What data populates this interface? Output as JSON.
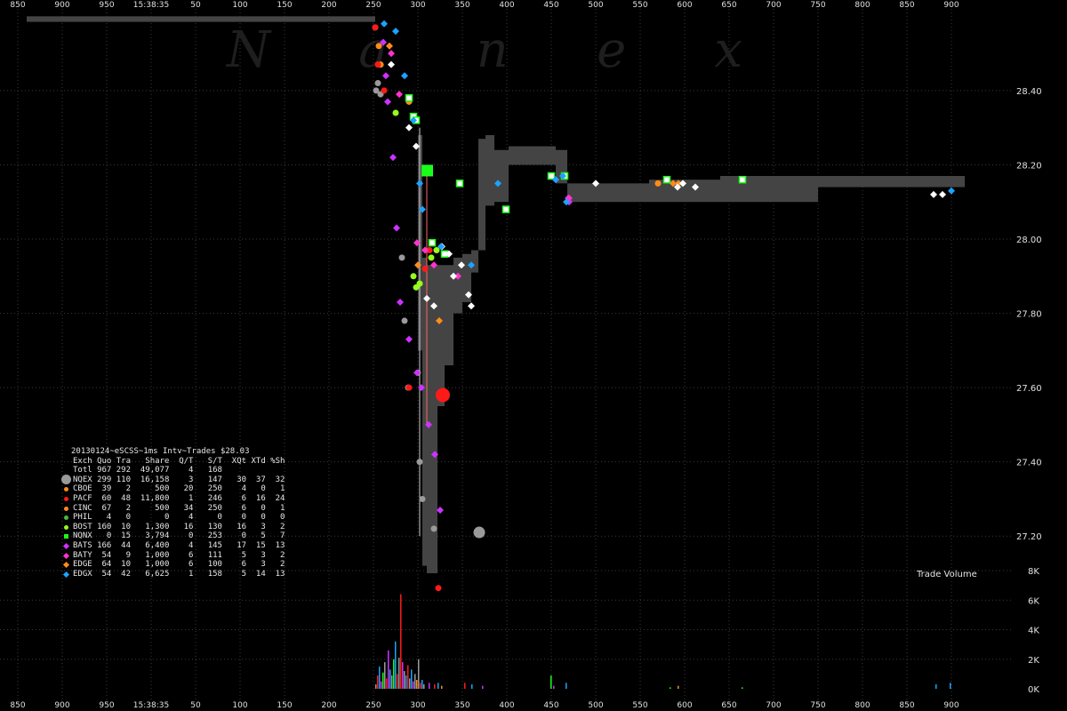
{
  "watermark": "Nanex",
  "chart_data": {
    "type": "scatter",
    "x_axis_labels": [
      "850",
      "900",
      "950",
      "15:38:35",
      "50",
      "100",
      "150",
      "200",
      "250",
      "300",
      "350",
      "400",
      "450",
      "500",
      "550",
      "600",
      "650",
      "700",
      "750",
      "800",
      "850",
      "900"
    ],
    "y_axis_labels": [
      "28.40",
      "28.20",
      "28.00",
      "27.80",
      "27.60",
      "27.40",
      "27.20"
    ],
    "volume_axis_labels": [
      "8K",
      "6K",
      "4K",
      "2K",
      "0K"
    ],
    "volume_label": "Trade Volume",
    "ylim": [
      27.1,
      28.62
    ],
    "nbbo_band": [
      {
        "x0": -140,
        "x1": 252,
        "lo": 28.585,
        "hi": 28.6
      },
      {
        "x0": 300,
        "x1": 305,
        "lo": 27.7,
        "hi": 28.28
      },
      {
        "x0": 305,
        "x1": 310,
        "lo": 27.12,
        "hi": 27.95
      },
      {
        "x0": 310,
        "x1": 322,
        "lo": 27.1,
        "hi": 27.93
      },
      {
        "x0": 322,
        "x1": 330,
        "lo": 27.55,
        "hi": 27.93
      },
      {
        "x0": 330,
        "x1": 340,
        "lo": 27.66,
        "hi": 27.93
      },
      {
        "x0": 340,
        "x1": 350,
        "lo": 27.8,
        "hi": 27.95
      },
      {
        "x0": 350,
        "x1": 360,
        "lo": 27.83,
        "hi": 27.96
      },
      {
        "x0": 360,
        "x1": 368,
        "lo": 27.91,
        "hi": 27.97
      },
      {
        "x0": 368,
        "x1": 376,
        "lo": 27.97,
        "hi": 28.27
      },
      {
        "x0": 376,
        "x1": 386,
        "lo": 28.09,
        "hi": 28.28
      },
      {
        "x0": 386,
        "x1": 402,
        "lo": 28.1,
        "hi": 28.24
      },
      {
        "x0": 402,
        "x1": 455,
        "lo": 28.2,
        "hi": 28.25
      },
      {
        "x0": 455,
        "x1": 468,
        "lo": 28.15,
        "hi": 28.24
      },
      {
        "x0": 468,
        "x1": 560,
        "lo": 28.1,
        "hi": 28.15
      },
      {
        "x0": 560,
        "x1": 640,
        "lo": 28.1,
        "hi": 28.16
      },
      {
        "x0": 640,
        "x1": 750,
        "lo": 28.1,
        "hi": 28.17
      },
      {
        "x0": 750,
        "x1": 820,
        "lo": 28.14,
        "hi": 28.17
      },
      {
        "x0": 820,
        "x1": 915,
        "lo": 28.14,
        "hi": 28.17
      }
    ],
    "series": [
      {
        "name": "NQEX",
        "color": "#9a9a9a",
        "shape": "circle",
        "x": [
          252,
          253,
          255,
          258,
          282,
          285,
          289,
          300,
          302,
          305,
          318
        ],
        "y": [
          28.57,
          28.4,
          28.42,
          28.39,
          27.95,
          27.78,
          27.6,
          27.64,
          27.4,
          27.3,
          27.22
        ]
      },
      {
        "name": "CBOE",
        "color": "#ff8c1a",
        "shape": "circle",
        "x": [
          256,
          258,
          290,
          347,
          570
        ],
        "y": [
          28.52,
          28.47,
          28.37,
          28.15,
          28.15
        ]
      },
      {
        "name": "PACF",
        "color": "#ff1a1a",
        "shape": "circle",
        "x": [
          252,
          255,
          262,
          290,
          308,
          313,
          323
        ],
        "y": [
          28.57,
          28.47,
          28.4,
          27.6,
          27.92,
          27.97,
          27.06
        ]
      },
      {
        "name": "CINC",
        "color": "#ff8c1a",
        "shape": "diamond",
        "x": [
          268,
          300,
          324,
          587,
          593
        ],
        "y": [
          28.52,
          27.93,
          27.78,
          28.15,
          28.15
        ]
      },
      {
        "name": "BOST",
        "color": "#96ff1a",
        "shape": "circle",
        "x": [
          275,
          295,
          298,
          302,
          315,
          321
        ],
        "y": [
          28.34,
          27.9,
          27.87,
          27.88,
          27.95,
          27.97
        ]
      },
      {
        "name": "NQNX",
        "color": "#1aff1a",
        "shape": "square",
        "x": [
          290,
          295,
          298,
          316,
          330,
          347,
          399,
          450,
          465,
          580,
          665
        ],
        "y": [
          28.38,
          28.33,
          28.32,
          27.99,
          27.96,
          28.15,
          28.08,
          28.17,
          28.17,
          28.16,
          28.16
        ]
      },
      {
        "name": "BATS",
        "color": "#cc33ff",
        "shape": "diamond",
        "x": [
          261,
          264,
          266,
          272,
          276,
          280,
          290,
          299,
          304,
          312,
          319,
          325,
          455,
          469,
          470
        ],
        "y": [
          28.53,
          28.44,
          28.37,
          28.22,
          28.03,
          27.83,
          27.73,
          27.64,
          27.6,
          27.5,
          27.42,
          27.27,
          28.16,
          28.11,
          28.1
        ]
      },
      {
        "name": "BATY",
        "color": "#ff33cc",
        "shape": "diamond",
        "x": [
          270,
          279,
          299,
          308,
          318,
          345,
          470
        ],
        "y": [
          28.5,
          28.39,
          27.99,
          27.97,
          27.93,
          27.9,
          28.11
        ]
      },
      {
        "name": "EDGE",
        "color": "#ffffff",
        "shape": "diamond",
        "x": [
          270,
          290,
          298,
          310,
          318,
          327,
          335,
          340,
          349,
          357,
          360,
          500,
          592,
          598,
          612,
          880,
          890
        ],
        "y": [
          28.47,
          28.3,
          28.25,
          27.84,
          27.82,
          27.98,
          27.96,
          27.9,
          27.93,
          27.85,
          27.82,
          28.15,
          28.14,
          28.15,
          28.14,
          28.12,
          28.12
        ]
      },
      {
        "name": "EDGX",
        "color": "#1aa3ff",
        "shape": "diamond",
        "x": [
          262,
          275,
          285,
          295,
          302,
          305,
          326,
          360,
          390,
          455,
          463,
          467,
          900
        ],
        "y": [
          28.58,
          28.56,
          28.44,
          28.32,
          28.15,
          28.08,
          27.98,
          27.93,
          28.15,
          28.16,
          28.17,
          28.1,
          28.13
        ]
      }
    ],
    "legend_title": "20130124~eSCSS~1ms Intv~Trades $28.03",
    "legend_columns": [
      "Exch",
      "Quo",
      "Tra",
      "Share",
      "Q/T",
      "S/T",
      "XQt",
      "XTd",
      "%Sh"
    ],
    "legend_rows": [
      {
        "exch": "Totl",
        "quo": "967",
        "tra": "292",
        "share": "49,077",
        "qt": "4",
        "st": "168",
        "xqt": "",
        "xtd": "",
        "sh": ""
      },
      {
        "exch": "NQEX",
        "quo": "299",
        "tra": "110",
        "share": "16,158",
        "qt": "3",
        "st": "147",
        "xqt": "30",
        "xtd": "37",
        "sh": "32"
      },
      {
        "exch": "CBOE",
        "quo": "39",
        "tra": "2",
        "share": "500",
        "qt": "20",
        "st": "250",
        "xqt": "4",
        "xtd": "0",
        "sh": "1"
      },
      {
        "exch": "PACF",
        "quo": "60",
        "tra": "48",
        "share": "11,800",
        "qt": "1",
        "st": "246",
        "xqt": "6",
        "xtd": "16",
        "sh": "24"
      },
      {
        "exch": "CINC",
        "quo": "67",
        "tra": "2",
        "share": "500",
        "qt": "34",
        "st": "250",
        "xqt": "6",
        "xtd": "0",
        "sh": "1"
      },
      {
        "exch": "PHIL",
        "quo": "4",
        "tra": "0",
        "share": "0",
        "qt": "4",
        "st": "0",
        "xqt": "0",
        "xtd": "0",
        "sh": "0"
      },
      {
        "exch": "BOST",
        "quo": "160",
        "tra": "10",
        "share": "1,300",
        "qt": "16",
        "st": "130",
        "xqt": "16",
        "xtd": "3",
        "sh": "2"
      },
      {
        "exch": "NQNX",
        "quo": "0",
        "tra": "15",
        "share": "3,794",
        "qt": "0",
        "st": "253",
        "xqt": "0",
        "xtd": "5",
        "sh": "7"
      },
      {
        "exch": "BATS",
        "quo": "166",
        "tra": "44",
        "share": "6,400",
        "qt": "4",
        "st": "145",
        "xqt": "17",
        "xtd": "15",
        "sh": "13"
      },
      {
        "exch": "BATY",
        "quo": "54",
        "tra": "9",
        "share": "1,000",
        "qt": "6",
        "st": "111",
        "xqt": "5",
        "xtd": "3",
        "sh": "2"
      },
      {
        "exch": "EDGE",
        "quo": "64",
        "tra": "10",
        "share": "1,000",
        "qt": "6",
        "st": "100",
        "xqt": "6",
        "xtd": "3",
        "sh": "2"
      },
      {
        "exch": "EDGX",
        "quo": "54",
        "tra": "42",
        "share": "6,625",
        "qt": "1",
        "st": "158",
        "xqt": "5",
        "xtd": "14",
        "sh": "13"
      }
    ],
    "legend_markers": {
      "NQEX": {
        "color": "#9a9a9a",
        "shape": "big"
      },
      "CBOE": {
        "color": "#ff8c1a",
        "shape": "dot"
      },
      "PACF": {
        "color": "#ff1a1a",
        "shape": "dot"
      },
      "CINC": {
        "color": "#ff8c1a",
        "shape": "dot"
      },
      "PHIL": {
        "color": "#40c040",
        "shape": "dot"
      },
      "BOST": {
        "color": "#96ff1a",
        "shape": "dot"
      },
      "NQNX": {
        "color": "#1aff1a",
        "shape": "sq"
      },
      "BATS": {
        "color": "#cc33ff",
        "shape": "dia"
      },
      "BATY": {
        "color": "#ff33cc",
        "shape": "dia"
      },
      "EDGE": {
        "color": "#ff8c1a",
        "shape": "dia"
      },
      "EDGX": {
        "color": "#1aa3ff",
        "shape": "dia"
      }
    },
    "volume_bars": [
      {
        "x": 252,
        "v": 300,
        "c": "#9a9a9a"
      },
      {
        "x": 254,
        "v": 900,
        "c": "#ff1a1a"
      },
      {
        "x": 256,
        "v": 1500,
        "c": "#1aa3ff"
      },
      {
        "x": 258,
        "v": 500,
        "c": "#cc33ff"
      },
      {
        "x": 260,
        "v": 1100,
        "c": "#1aff1a"
      },
      {
        "x": 262,
        "v": 1800,
        "c": "#9a9a9a"
      },
      {
        "x": 264,
        "v": 700,
        "c": "#ff1a1a"
      },
      {
        "x": 266,
        "v": 2600,
        "c": "#cc33ff"
      },
      {
        "x": 268,
        "v": 1300,
        "c": "#1aa3ff"
      },
      {
        "x": 270,
        "v": 900,
        "c": "#9a9a9a"
      },
      {
        "x": 272,
        "v": 2000,
        "c": "#1aff1a"
      },
      {
        "x": 274,
        "v": 3200,
        "c": "#1aa3ff"
      },
      {
        "x": 276,
        "v": 1000,
        "c": "#ff1a1a"
      },
      {
        "x": 278,
        "v": 2100,
        "c": "#9a9a9a"
      },
      {
        "x": 280,
        "v": 6400,
        "c": "#ff1a1a"
      },
      {
        "x": 282,
        "v": 1800,
        "c": "#cc33ff"
      },
      {
        "x": 284,
        "v": 1200,
        "c": "#9a9a9a"
      },
      {
        "x": 286,
        "v": 900,
        "c": "#1aa3ff"
      },
      {
        "x": 288,
        "v": 1600,
        "c": "#ff1a1a"
      },
      {
        "x": 290,
        "v": 700,
        "c": "#9a9a9a"
      },
      {
        "x": 292,
        "v": 1300,
        "c": "#1aa3ff"
      },
      {
        "x": 294,
        "v": 500,
        "c": "#cc33ff"
      },
      {
        "x": 296,
        "v": 1000,
        "c": "#9a9a9a"
      },
      {
        "x": 298,
        "v": 600,
        "c": "#ff8c1a"
      },
      {
        "x": 300,
        "v": 2000,
        "c": "#9a9a9a"
      },
      {
        "x": 302,
        "v": 400,
        "c": "#ff1a1a"
      },
      {
        "x": 304,
        "v": 600,
        "c": "#1aa3ff"
      },
      {
        "x": 306,
        "v": 300,
        "c": "#9a9a9a"
      },
      {
        "x": 312,
        "v": 400,
        "c": "#cc33ff"
      },
      {
        "x": 318,
        "v": 300,
        "c": "#ff1a1a"
      },
      {
        "x": 322,
        "v": 400,
        "c": "#1aa3ff"
      },
      {
        "x": 326,
        "v": 200,
        "c": "#ff8c1a"
      },
      {
        "x": 352,
        "v": 400,
        "c": "#ff1a1a"
      },
      {
        "x": 360,
        "v": 300,
        "c": "#1aa3ff"
      },
      {
        "x": 372,
        "v": 200,
        "c": "#cc33ff"
      },
      {
        "x": 449,
        "v": 900,
        "c": "#1aff1a"
      },
      {
        "x": 452,
        "v": 200,
        "c": "#cc33ff"
      },
      {
        "x": 466,
        "v": 400,
        "c": "#1aa3ff"
      },
      {
        "x": 583,
        "v": 100,
        "c": "#1aff1a"
      },
      {
        "x": 592,
        "v": 200,
        "c": "#ff8c1a"
      },
      {
        "x": 664,
        "v": 100,
        "c": "#1aff1a"
      },
      {
        "x": 882,
        "v": 300,
        "c": "#1aa3ff"
      },
      {
        "x": 898,
        "v": 400,
        "c": "#1aa3ff"
      }
    ],
    "volume_ylim": [
      0,
      8000
    ]
  }
}
